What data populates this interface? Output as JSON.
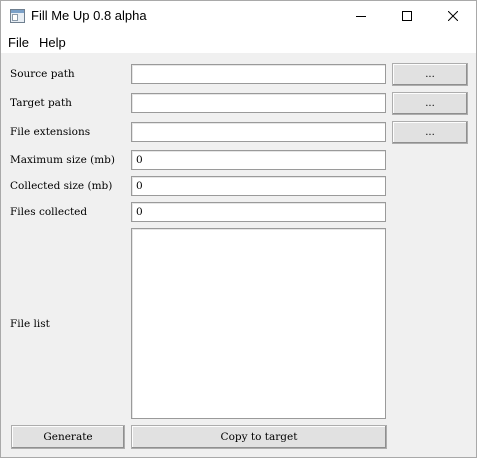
{
  "window": {
    "title": "Fill Me Up 0.8 alpha"
  },
  "menu": {
    "file": "File",
    "help": "Help"
  },
  "form": {
    "source_path": {
      "label": "Source path",
      "value": "",
      "browse_label": "..."
    },
    "target_path": {
      "label": "Target path",
      "value": "",
      "browse_label": "..."
    },
    "file_extensions": {
      "label": "File extensions",
      "value": "",
      "browse_label": "..."
    },
    "maximum_size": {
      "label": "Maximum size (mb)",
      "value": "0"
    },
    "collected_size": {
      "label": "Collected size (mb)",
      "value": "0"
    },
    "files_collected": {
      "label": "Files collected",
      "value": "0"
    },
    "file_list": {
      "label": "File list"
    }
  },
  "actions": {
    "generate": "Generate",
    "copy_to_target": "Copy to target"
  },
  "icons": {
    "app": "app-window-icon",
    "minimize": "minimize-icon",
    "maximize": "maximize-icon",
    "close": "close-icon"
  }
}
